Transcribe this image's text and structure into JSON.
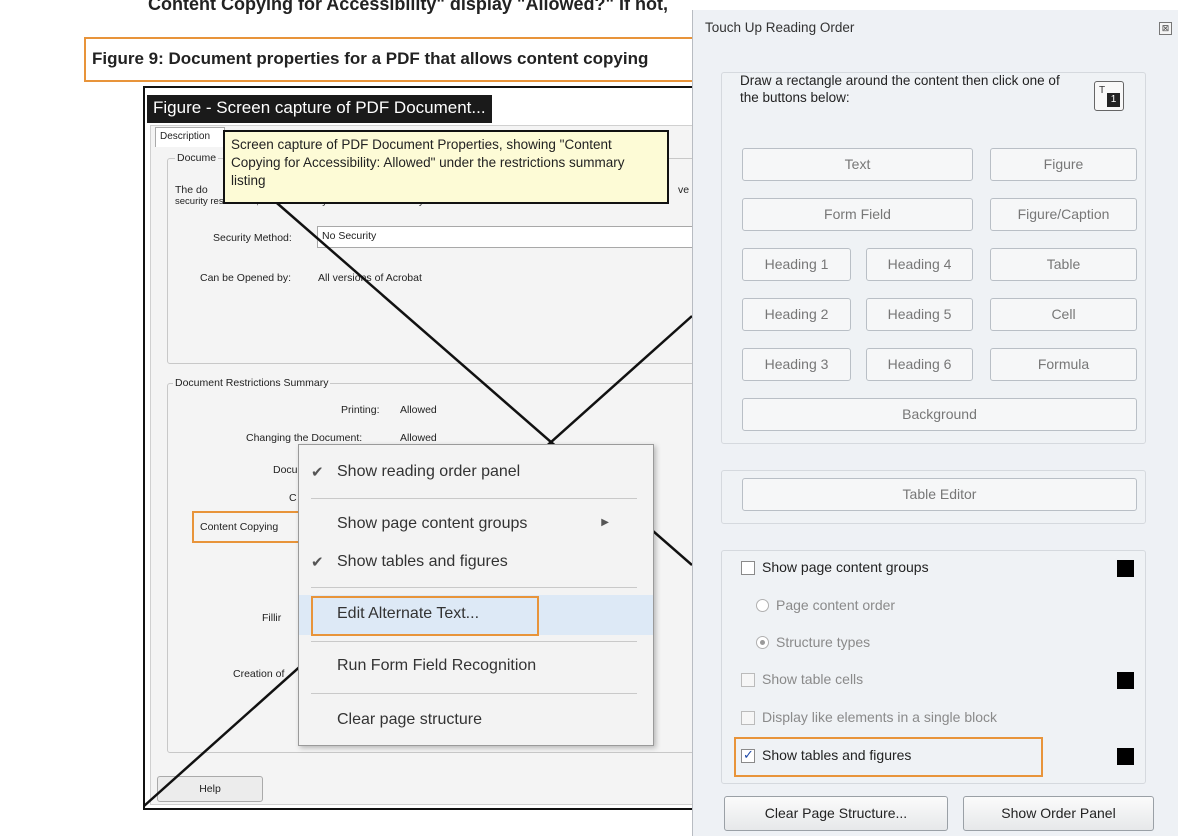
{
  "document": {
    "top_text": "Content Copying for Accessibility\" display \"Allowed?\" If not,",
    "figure_caption": "Figure 9: Document properties for a PDF that allows content copying",
    "figure_tag": "Figure - Screen capture of PDF Document...",
    "tooltip": "Screen capture of PDF Document Properties, showing \"Content Copying for Accessibility: Allowed\"  under the restrictions summary listing",
    "dialog": {
      "tab_label": "Description",
      "section1_label": "Docume",
      "desc_line1": "The do",
      "desc_line1_end": "ve",
      "desc_line2": "security restrictions, set the Security Method to No Security.",
      "security_method_label": "Security Method:",
      "security_method_value": "No Security",
      "opened_by_label": "Can be Opened by:",
      "opened_by_value": "All versions of Acrobat",
      "restrictions_label": "Document Restrictions Summary",
      "printing_label": "Printing:",
      "printing_value": "Allowed",
      "changing_label": "Changing the Document:",
      "changing_value": "Allowed",
      "partial_docu": "Docu",
      "partial_c": "C",
      "content_copying": "Content Copying",
      "partial_fill": "Fillir",
      "partial_creation": "Creation of",
      "help": "Help"
    }
  },
  "context_menu": {
    "items": [
      {
        "label": "Show reading order panel",
        "checked": true
      },
      {
        "label": "Show page content groups",
        "submenu": true
      },
      {
        "label": "Show tables and figures",
        "checked": true
      },
      {
        "label": "Edit Alternate Text...",
        "highlighted": true
      },
      {
        "label": "Run Form Field Recognition"
      },
      {
        "label": "Clear page structure"
      }
    ]
  },
  "panel": {
    "title": "Touch Up Reading Order",
    "instructions": "Draw a rectangle around the content then click one of the buttons below:",
    "buttons": {
      "text": "Text",
      "figure": "Figure",
      "form_field": "Form Field",
      "figure_caption": "Figure/Caption",
      "heading1": "Heading 1",
      "heading4": "Heading 4",
      "table": "Table",
      "heading2": "Heading 2",
      "heading5": "Heading 5",
      "cell": "Cell",
      "heading3": "Heading 3",
      "heading6": "Heading 6",
      "formula": "Formula",
      "background": "Background",
      "table_editor": "Table Editor"
    },
    "options": {
      "show_page_content_groups": "Show page content groups",
      "page_content_order": "Page content order",
      "structure_types": "Structure types",
      "show_table_cells": "Show table cells",
      "display_like_elements": "Display like elements in a single block",
      "show_tables_and_figures": "Show tables and figures"
    },
    "bottom": {
      "clear_page_structure": "Clear Page Structure...",
      "show_order_panel": "Show Order Panel"
    }
  },
  "colors": {
    "highlight_orange": "#e8943a",
    "tooltip_bg": "#fdfbd6",
    "menu_highlight": "#dde9f6",
    "panel_bg": "#eef1f5"
  }
}
